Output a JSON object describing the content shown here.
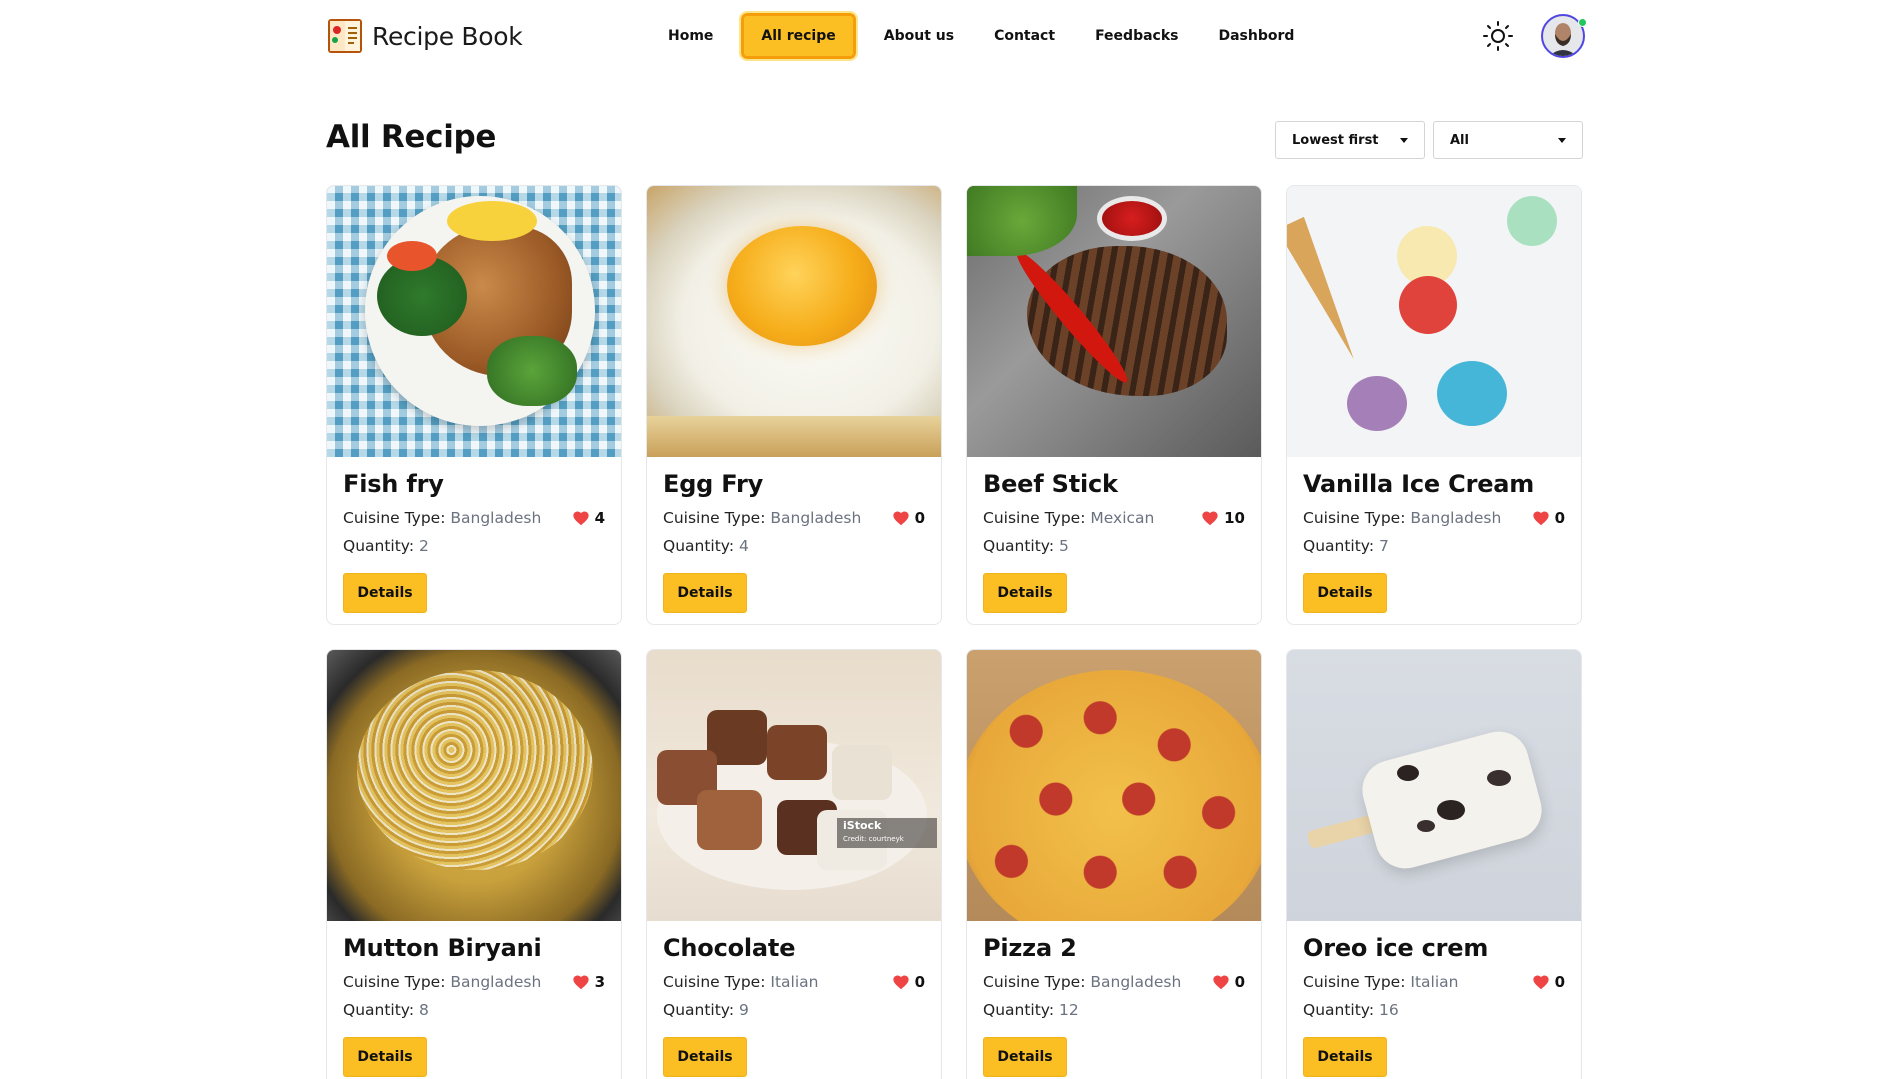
{
  "brand": {
    "name": "Recipe Book"
  },
  "nav": {
    "items": [
      "Home",
      "All recipe",
      "About us",
      "Contact",
      "Feedbacks",
      "Dashbord"
    ],
    "active_index": 1
  },
  "header": {
    "title": "All Recipe",
    "sort_value": "Lowest first",
    "filter_value": "All"
  },
  "labels": {
    "cuisine": "Cuisine Type:",
    "quantity": "Quantity:",
    "details": "Details"
  },
  "colors": {
    "accent": "#fbbf24",
    "heart": "#ef4444"
  },
  "recipes": [
    {
      "name": "Fish fry",
      "cuisine": "Bangladesh",
      "likes": "4",
      "quantity": "2",
      "image": "fish-fry-photo"
    },
    {
      "name": "Egg Fry",
      "cuisine": "Bangladesh",
      "likes": "0",
      "quantity": "4",
      "image": "egg-fry-photo"
    },
    {
      "name": "Beef Stick",
      "cuisine": "Mexican",
      "likes": "10",
      "quantity": "5",
      "image": "beef-steak-photo"
    },
    {
      "name": "Vanilla Ice Cream",
      "cuisine": "Bangladesh",
      "likes": "0",
      "quantity": "7",
      "image": "ice-cream-cones-photo"
    },
    {
      "name": "Mutton Biryani",
      "cuisine": "Bangladesh",
      "likes": "3",
      "quantity": "8",
      "image": "biryani-photo"
    },
    {
      "name": "Chocolate",
      "cuisine": "Italian",
      "likes": "0",
      "quantity": "9",
      "image": "chocolates-photo"
    },
    {
      "name": "Pizza 2",
      "cuisine": "Bangladesh",
      "likes": "0",
      "quantity": "12",
      "image": "pepperoni-pizza-photo"
    },
    {
      "name": "Oreo ice crem",
      "cuisine": "Italian",
      "likes": "0",
      "quantity": "16",
      "image": "oreo-ice-pop-photo"
    }
  ],
  "watermark": {
    "text": "iStock",
    "credit": "Credit: courtneyk"
  }
}
